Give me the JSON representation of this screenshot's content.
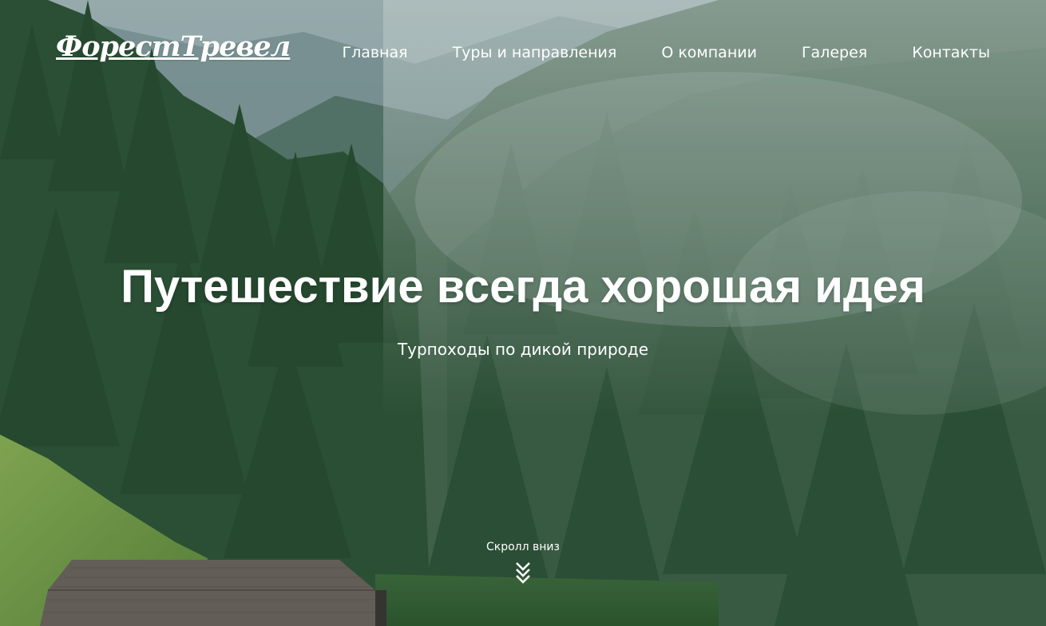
{
  "brand": {
    "logo_text": "ФорестТревел"
  },
  "nav": {
    "items": [
      {
        "label": "Главная"
      },
      {
        "label": "Туры и направления"
      },
      {
        "label": "О компании"
      },
      {
        "label": "Галерея"
      },
      {
        "label": "Контакты"
      }
    ]
  },
  "hero": {
    "title": "Путешествие всегда хорошая идея",
    "subtitle": "Турпоходы по дикой природе",
    "background_description_icon": "forest-mountain-photo"
  },
  "scroll": {
    "label": "Скролл вниз",
    "icon": "double-chevron-down-icon"
  },
  "colors": {
    "text": "#ffffff",
    "sky": "#9fb4b9",
    "forest_dark": "#2f4d35",
    "forest_light": "#4d6e5c",
    "meadow": "#7fa84a",
    "roof": "#6f6560"
  }
}
